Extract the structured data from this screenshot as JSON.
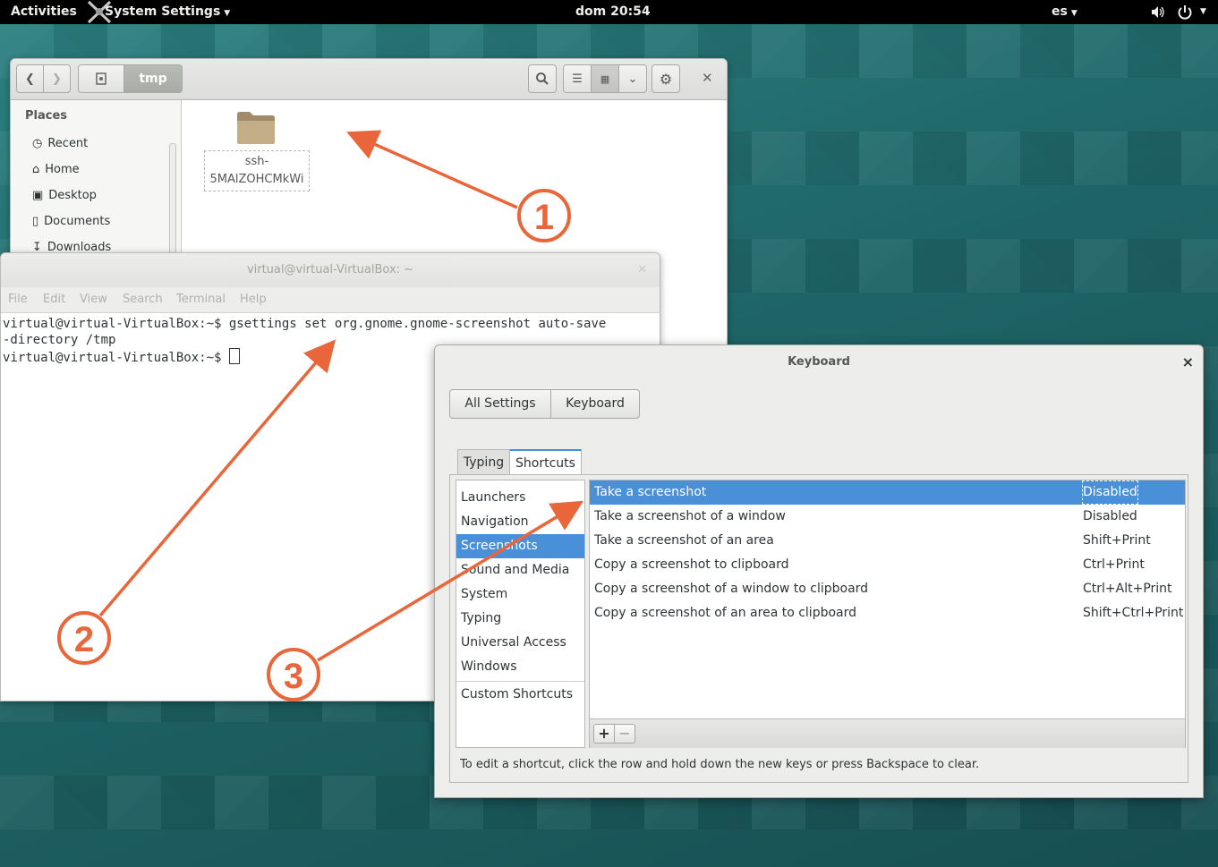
{
  "topbar": {
    "activities": "Activities",
    "app_menu": "System Settings",
    "clock": "dom 20:54",
    "input_source": "es"
  },
  "files": {
    "path_current": "tmp",
    "sidebar_heading": "Places",
    "places": [
      "Recent",
      "Home",
      "Desktop",
      "Documents",
      "Downloads"
    ],
    "folder_name_line1": "ssh-",
    "folder_name_line2": "5MAlZOHCMkWi"
  },
  "terminal": {
    "title": "virtual@virtual-VirtualBox: ~",
    "menu": [
      "File",
      "Edit",
      "View",
      "Search",
      "Terminal",
      "Help"
    ],
    "line1": "virtual@virtual-VirtualBox:~$ gsettings set org.gnome.gnome-screenshot auto-save",
    "line2": "-directory /tmp",
    "line3": "virtual@virtual-VirtualBox:~$ "
  },
  "keyboard": {
    "title": "Keyboard",
    "close": "×",
    "nav_all": "All Settings",
    "nav_current": "Keyboard",
    "tab_typing": "Typing",
    "tab_shortcuts": "Shortcuts",
    "categories": [
      "Launchers",
      "Navigation",
      "Screenshots",
      "Sound and Media",
      "System",
      "Typing",
      "Universal Access",
      "Windows"
    ],
    "custom_category": "Custom Shortcuts",
    "selected_category": "Screenshots",
    "shortcuts": [
      {
        "name": "Take a screenshot",
        "key": "Disabled"
      },
      {
        "name": "Take a screenshot of a window",
        "key": "Disabled"
      },
      {
        "name": "Take a screenshot of an area",
        "key": "Shift+Print"
      },
      {
        "name": "Copy a screenshot to clipboard",
        "key": "Ctrl+Print"
      },
      {
        "name": "Copy a screenshot of a window to clipboard",
        "key": "Ctrl+Alt+Print"
      },
      {
        "name": "Copy a screenshot of an area to clipboard",
        "key": "Shift+Ctrl+Print"
      }
    ],
    "add": "+",
    "remove": "−",
    "hint": "To edit a shortcut, click the row and hold down the new keys or press Backspace to clear."
  },
  "annotations": {
    "marker1": "1",
    "marker2": "2",
    "marker3": "3",
    "color": "#e8663a"
  }
}
